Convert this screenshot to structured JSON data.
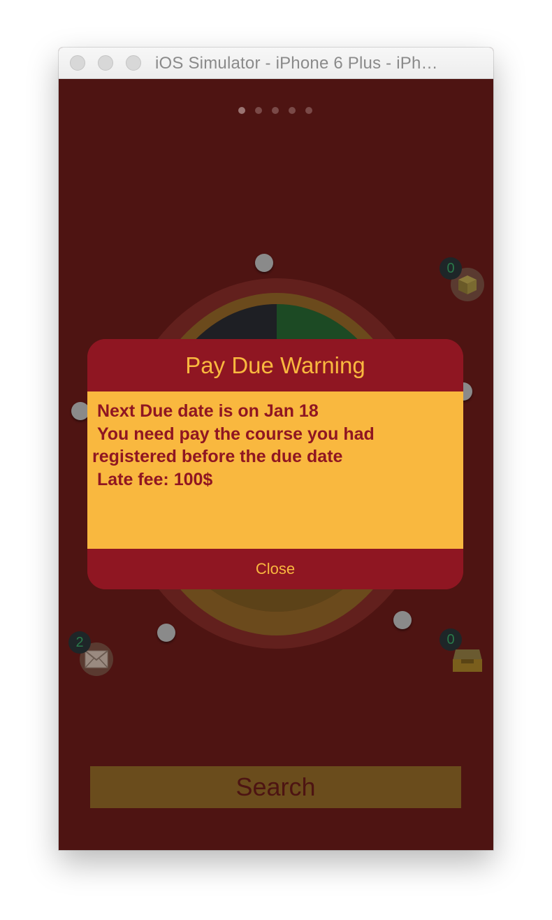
{
  "window": {
    "title": "iOS Simulator - iPhone 6 Plus - iPh…"
  },
  "pager": {
    "count": 5,
    "active_index": 0
  },
  "badges": {
    "top_right": "0",
    "bottom_left": "2",
    "bottom_right": "0"
  },
  "icons": {
    "top_right": "package-box-icon",
    "bottom_left": "envelope-icon",
    "bottom_right": "inbox-tray-icon"
  },
  "search": {
    "label": "Search"
  },
  "alert": {
    "title": "Pay Due Warning",
    "message": " Next Due date is on Jan 18\n You need pay the course you had\nregistered before the due date\n Late fee: 100$",
    "close_label": "Close"
  },
  "colors": {
    "background": "#4e1412",
    "alert_red": "#8f1622",
    "alert_gold": "#f9b83f"
  }
}
